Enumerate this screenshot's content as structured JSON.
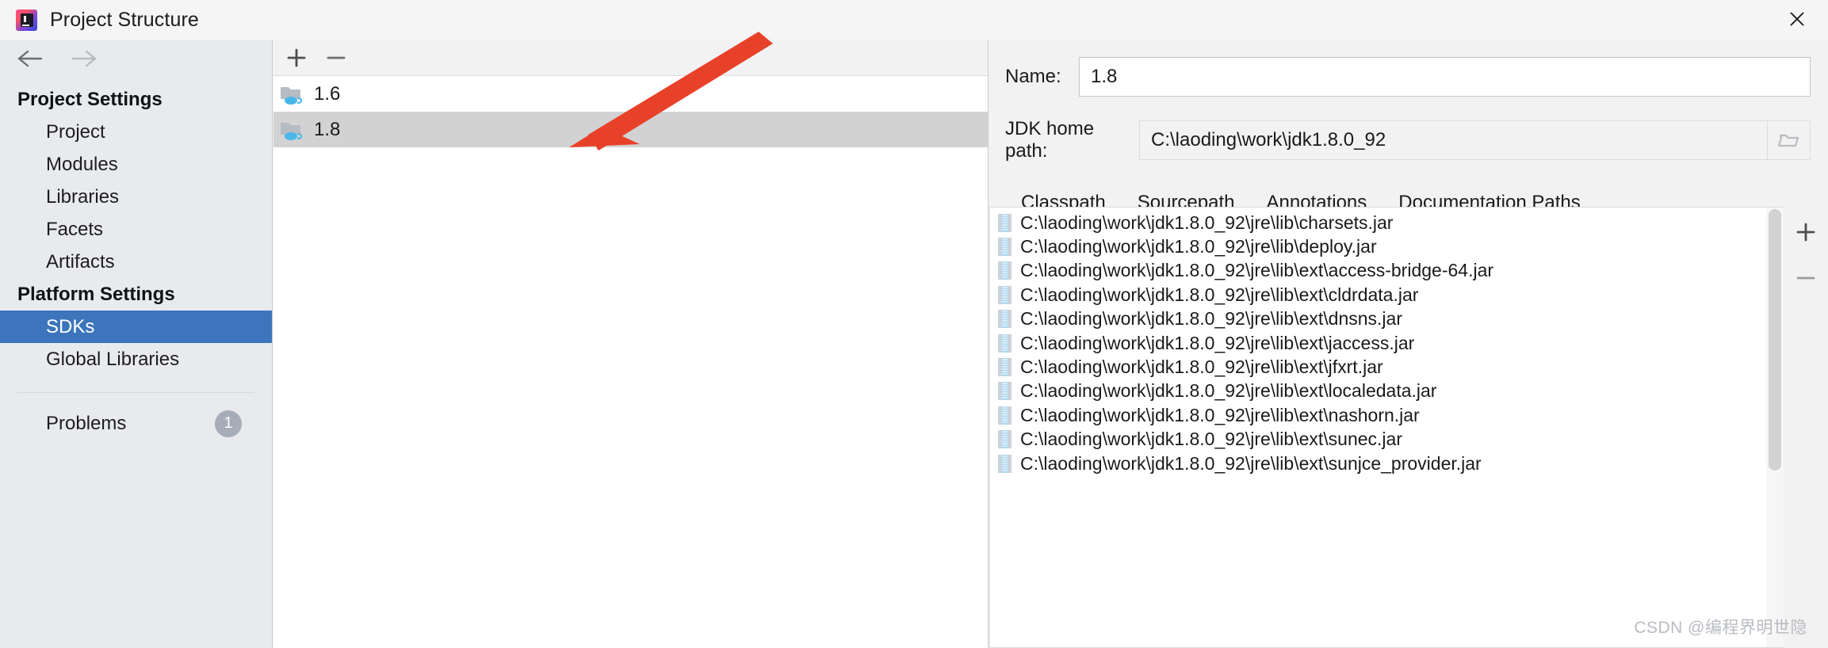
{
  "window": {
    "title": "Project Structure",
    "app_icon": "intellij-idea-icon",
    "close_label": "×"
  },
  "nav": {
    "back_label": "←",
    "forward_label": "→"
  },
  "sidebar": {
    "sections": [
      {
        "title": "Project Settings",
        "items": [
          {
            "label": "Project",
            "selected": false
          },
          {
            "label": "Modules",
            "selected": false
          },
          {
            "label": "Libraries",
            "selected": false
          },
          {
            "label": "Facets",
            "selected": false
          },
          {
            "label": "Artifacts",
            "selected": false
          }
        ]
      },
      {
        "title": "Platform Settings",
        "items": [
          {
            "label": "SDKs",
            "selected": true
          },
          {
            "label": "Global Libraries",
            "selected": false
          }
        ]
      }
    ],
    "problems": {
      "label": "Problems",
      "count": "1"
    }
  },
  "sdk_panel": {
    "toolbar": {
      "add_label": "+",
      "remove_label": "−"
    },
    "items": [
      {
        "name": "1.6",
        "selected": false
      },
      {
        "name": "1.8",
        "selected": true
      }
    ]
  },
  "detail": {
    "name_label": "Name:",
    "name_value": "1.8",
    "name_placeholder": "",
    "home_label": "JDK home path:",
    "home_value": "C:\\laoding\\work\\jdk1.8.0_92",
    "home_placeholder": "",
    "browse_icon": "folder-icon",
    "tabs": [
      {
        "label": "Classpath",
        "active": true
      },
      {
        "label": "Sourcepath",
        "active": false
      },
      {
        "label": "Annotations",
        "active": false
      },
      {
        "label": "Documentation Paths",
        "active": false
      }
    ],
    "classpath": {
      "add_label": "+",
      "remove_label": "−",
      "entries": [
        "C:\\laoding\\work\\jdk1.8.0_92\\jre\\lib\\charsets.jar",
        "C:\\laoding\\work\\jdk1.8.0_92\\jre\\lib\\deploy.jar",
        "C:\\laoding\\work\\jdk1.8.0_92\\jre\\lib\\ext\\access-bridge-64.jar",
        "C:\\laoding\\work\\jdk1.8.0_92\\jre\\lib\\ext\\cldrdata.jar",
        "C:\\laoding\\work\\jdk1.8.0_92\\jre\\lib\\ext\\dnsns.jar",
        "C:\\laoding\\work\\jdk1.8.0_92\\jre\\lib\\ext\\jaccess.jar",
        "C:\\laoding\\work\\jdk1.8.0_92\\jre\\lib\\ext\\jfxrt.jar",
        "C:\\laoding\\work\\jdk1.8.0_92\\jre\\lib\\ext\\localedata.jar",
        "C:\\laoding\\work\\jdk1.8.0_92\\jre\\lib\\ext\\nashorn.jar",
        "C:\\laoding\\work\\jdk1.8.0_92\\jre\\lib\\ext\\sunec.jar",
        "C:\\laoding\\work\\jdk1.8.0_92\\jre\\lib\\ext\\sunjce_provider.jar"
      ]
    }
  },
  "annotation": {
    "arrow_color": "#e8412a"
  },
  "watermark": {
    "text": "CSDN @编程界明世隐"
  },
  "colors": {
    "selection_blue": "#3c75bb",
    "sidebar_bg": "#e8eaed",
    "panel_bg": "#f2f2f2",
    "row_selected_gray": "#d2d2d2"
  }
}
